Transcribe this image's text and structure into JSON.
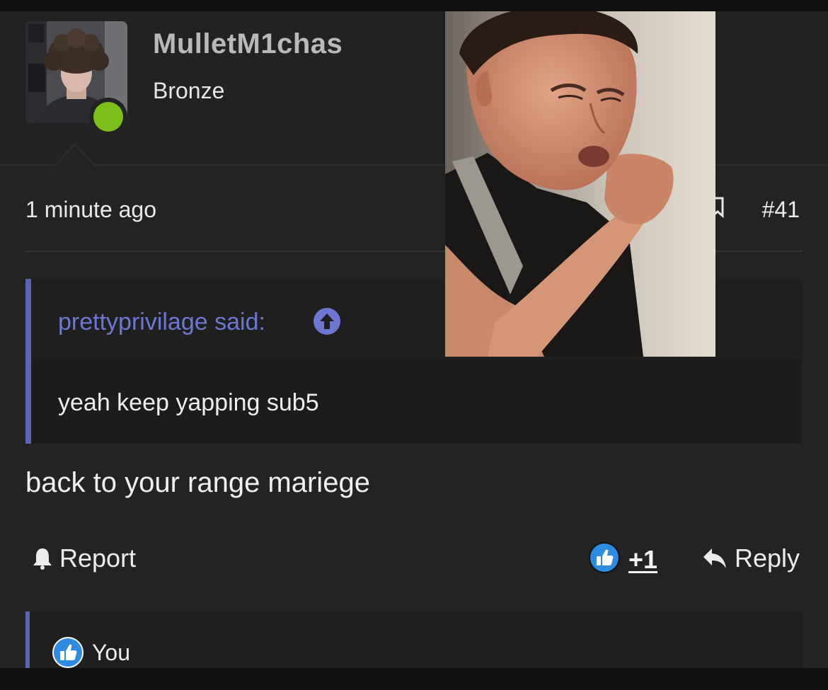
{
  "user": {
    "name": "MulletM1chas",
    "rank": "Bronze",
    "online": true,
    "avatar_icon": "user-avatar-photo"
  },
  "meta": {
    "time": "1 minute ago",
    "post_number": "#41"
  },
  "quote": {
    "author": "prettyprivilage said:",
    "text": "yeah keep yapping sub5"
  },
  "post": {
    "body": "back to your range mariege"
  },
  "actions": {
    "report_label": "Report",
    "like_count": "+1",
    "reply_label": "Reply"
  },
  "likes": {
    "text": "You"
  },
  "colors": {
    "accent": "#5b63b7",
    "online": "#7cbf1a",
    "like": "#2d8ce0"
  }
}
